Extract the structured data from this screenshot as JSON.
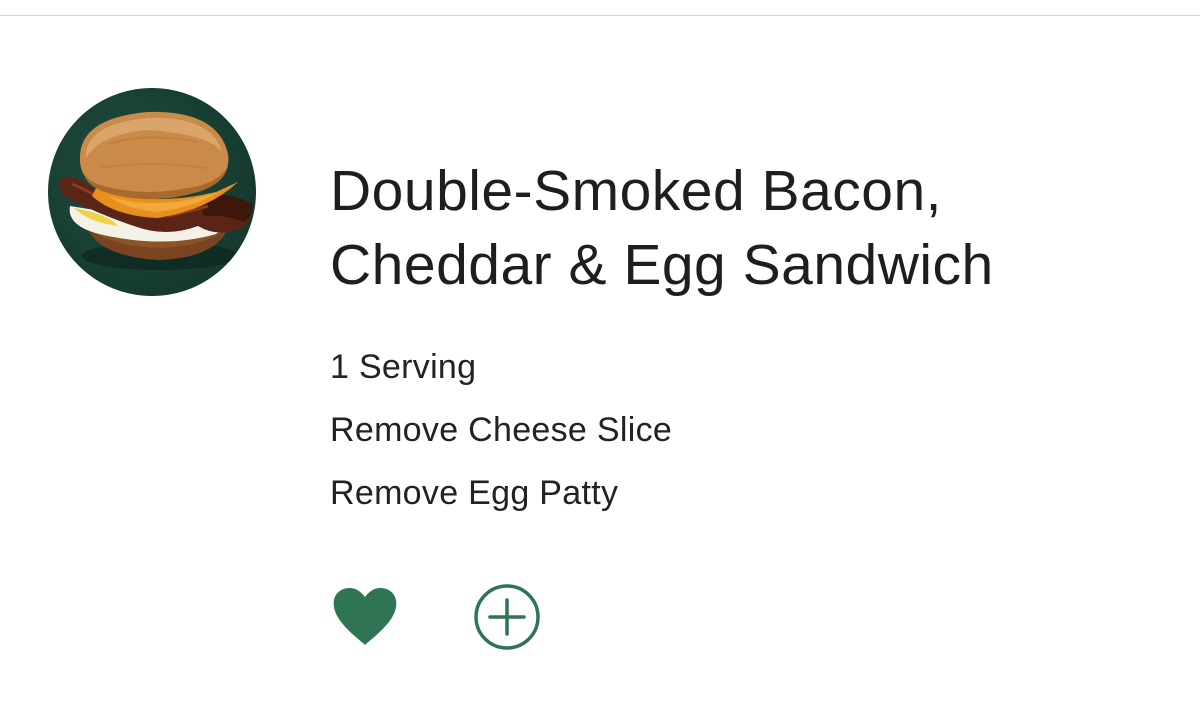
{
  "product": {
    "title_line1": "Double-Smoked Bacon,",
    "title_line2": "Cheddar & Egg Sandwich",
    "image_icon": "sandwich-image",
    "modifiers": [
      "1 Serving",
      "Remove Cheese Slice",
      "Remove Egg Patty"
    ]
  },
  "actions": {
    "favorite_icon": "heart-icon",
    "add_icon": "plus-circle-icon"
  },
  "colors": {
    "accent_green": "#2f7453",
    "image_background": "#163a30",
    "text": "#1e1e1e"
  }
}
